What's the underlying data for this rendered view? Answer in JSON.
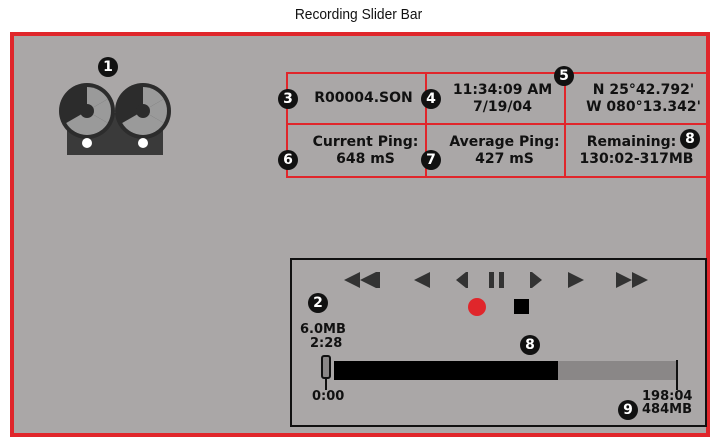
{
  "caption": "Recording Slider Bar",
  "callouts": {
    "c1": "1",
    "c2": "2",
    "c3": "3",
    "c4": "4",
    "c5": "5",
    "c6": "6",
    "c7": "7",
    "c8a": "8",
    "c8b": "8",
    "c9": "9"
  },
  "info": {
    "filename": "R00004.SON",
    "time": "11:34:09 AM",
    "date": "7/19/04",
    "lat": "N 25°42.792'",
    "lon": "W 080°13.342'",
    "current_ping_label": "Current Ping:",
    "current_ping_value": "648 mS",
    "average_ping_label": "Average Ping:",
    "average_ping_value": "427 mS",
    "remaining_label": "Remaining:",
    "remaining_value": "130:02-317MB"
  },
  "player": {
    "controls": [
      "rewind-icon",
      "step-back-icon",
      "frame-back-icon",
      "pause-icon",
      "frame-forward-icon",
      "play-icon",
      "fast-forward-icon"
    ],
    "current_size": "6.0MB",
    "current_time": "2:28",
    "start_time": "0:00",
    "end_time": "198:04",
    "end_size": "484MB",
    "recorded_fraction": 0.65,
    "playback_fraction": 0.0
  },
  "colors": {
    "frame": "#e0262b",
    "screen": "#aaa7a7",
    "record": "#e0262b"
  }
}
